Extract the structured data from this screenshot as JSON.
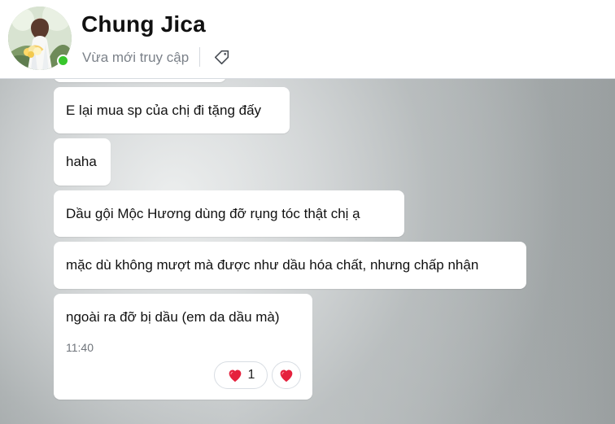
{
  "header": {
    "contact_name": "Chung Jica",
    "status_text": "Vừa mới truy cập",
    "avatar_icon": "profile-photo",
    "tag_icon": "tag-icon",
    "presence_color": "#37c62b"
  },
  "messages": [
    {
      "text": "E lại mua sp của chị đi tặng đấy"
    },
    {
      "text": "haha"
    },
    {
      "text": "Dầu gội Mộc Hương dùng đỡ rụng tóc thật chị ạ"
    },
    {
      "text": "mặc dù không mượt mà được như dầu hóa chất, nhưng chấp nhận"
    },
    {
      "text": "ngoài ra đỡ bị dầu (em da dầu mà)",
      "time": "11:40",
      "reaction_count": "1"
    }
  ],
  "reaction": {
    "icon": "heart",
    "color": "#e5213d"
  }
}
